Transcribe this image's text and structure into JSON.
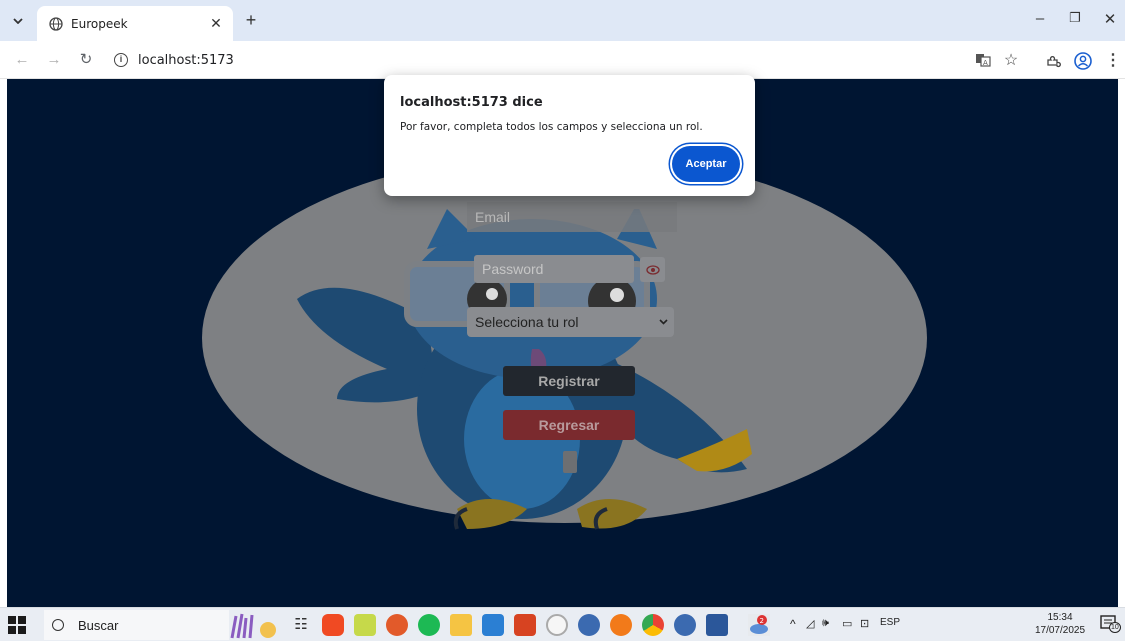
{
  "browser": {
    "tab_title": "Europeek",
    "url": "localhost:5173"
  },
  "page": {
    "email_placeholder": "Email",
    "password_placeholder": "Password",
    "role_select_value": "Selecciona tu rol",
    "register_label": "Registrar",
    "back_label": "Regresar",
    "background_color": "#001532"
  },
  "dialog": {
    "title": "localhost:5173 dice",
    "message": "Por favor, completa todos los campos y selecciona un rol.",
    "ok_label": "Aceptar",
    "accent_color": "#0b57d0"
  },
  "taskbar": {
    "search_label": "Buscar",
    "language": "ESP",
    "time": "15:34",
    "date": "17/07/2025",
    "notification_count": "10"
  }
}
